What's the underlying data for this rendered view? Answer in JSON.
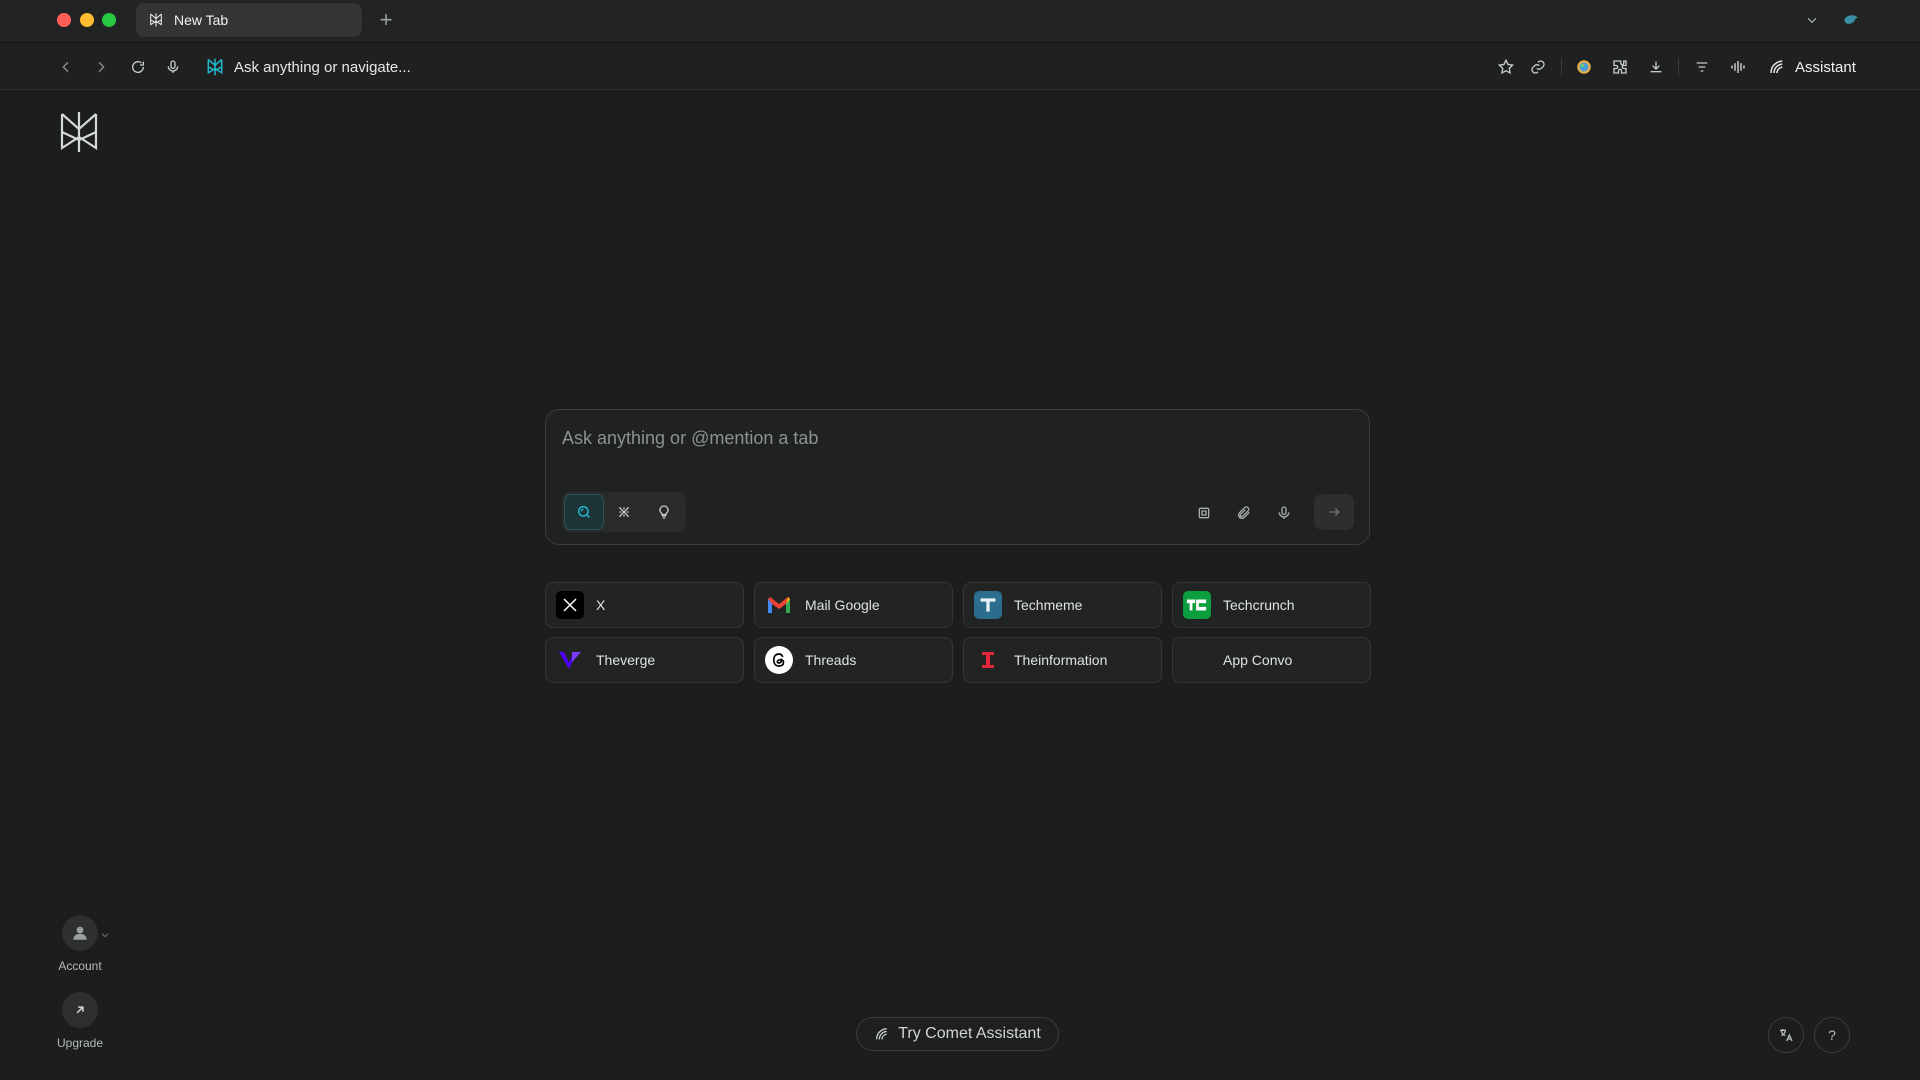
{
  "tab": {
    "title": "New Tab"
  },
  "toolbar": {
    "omnibox_text": "Ask anything or navigate...",
    "assistant_label": "Assistant"
  },
  "search": {
    "placeholder": "Ask anything or @mention a tab",
    "value": ""
  },
  "shortcuts": [
    {
      "label": "X"
    },
    {
      "label": "Mail Google"
    },
    {
      "label": "Techmeme"
    },
    {
      "label": "Techcrunch"
    },
    {
      "label": "Theverge"
    },
    {
      "label": "Threads"
    },
    {
      "label": "Theinformation"
    },
    {
      "label": "App Convo"
    }
  ],
  "sidebar": {
    "account_label": "Account",
    "upgrade_label": "Upgrade"
  },
  "footer": {
    "try_label": "Try Comet Assistant",
    "help_label": "?"
  },
  "colors": {
    "accent": "#20b8cd",
    "background": "#1c1d1d",
    "card": "#202222"
  },
  "icons": [
    "back-icon",
    "forward-icon",
    "reload-icon",
    "mic-icon",
    "star-icon",
    "link-icon",
    "extensions-icon",
    "download-icon",
    "menu-icon",
    "voice-icon",
    "assistant-icon",
    "search-icon",
    "research-icon",
    "lightbulb-icon",
    "screenshot-icon",
    "paperclip-icon",
    "arrow-right-icon",
    "translate-icon"
  ]
}
